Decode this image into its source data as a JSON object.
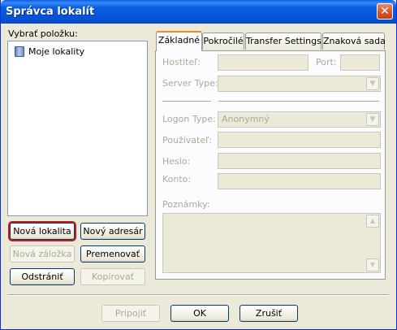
{
  "window": {
    "title": "Správca lokalít",
    "close_icon": "close-icon"
  },
  "left": {
    "select_label": "Vybrať položku:",
    "tree_items": [
      {
        "label": "Moje lokality",
        "icon": "site-folder-icon"
      }
    ],
    "buttons": {
      "new_site": "Nová lokalita",
      "new_folder": "Nový adresár",
      "new_bookmark": "Nová záložka",
      "rename": "Premenovať",
      "delete": "Odstrániť",
      "copy": "Kopírovať"
    }
  },
  "tabs": [
    {
      "label": "Základné",
      "active": true
    },
    {
      "label": "Pokročilé",
      "active": false
    },
    {
      "label": "Transfer Settings",
      "active": false
    },
    {
      "label": "Znaková sada",
      "active": false
    }
  ],
  "form": {
    "host_label": "Hostiteľ:",
    "host_value": "",
    "port_label": "Port:",
    "port_value": "",
    "server_type_label": "Server Type:",
    "server_type_value": "",
    "logon_type_label": "Logon Type:",
    "logon_type_value": "Anonymný",
    "user_label": "Používateľ:",
    "user_value": "",
    "password_label": "Heslo:",
    "password_value": "",
    "account_label": "Konto:",
    "account_value": "",
    "notes_label": "Poznámky:",
    "notes_value": ""
  },
  "footer": {
    "connect": "Pripojiť",
    "ok": "OK",
    "cancel": "Zrušiť"
  }
}
